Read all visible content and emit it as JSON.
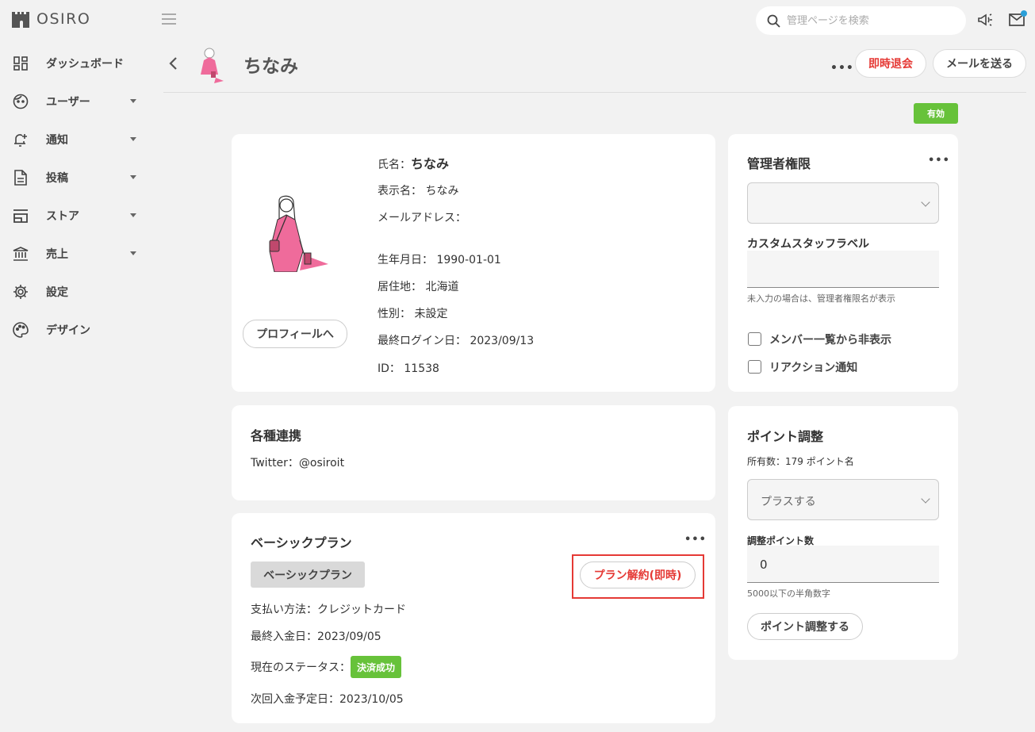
{
  "app": {
    "name": "OSIRO"
  },
  "sidebar": {
    "items": [
      {
        "label": "ダッシュボード",
        "icon": "dashboard-icon"
      },
      {
        "label": "ユーザー",
        "icon": "user-face-icon"
      },
      {
        "label": "通知",
        "icon": "bell-plus-icon"
      },
      {
        "label": "投稿",
        "icon": "document-icon"
      },
      {
        "label": "ストア",
        "icon": "store-icon"
      },
      {
        "label": "売上",
        "icon": "bank-icon"
      },
      {
        "label": "設定",
        "icon": "gear-icon"
      },
      {
        "label": "デザイン",
        "icon": "palette-icon"
      }
    ]
  },
  "search": {
    "placeholder": "管理ページを検索"
  },
  "header": {
    "name": "ちなみ",
    "withdraw_label": "即時退会",
    "send_mail_label": "メールを送る",
    "status_badge": "有効"
  },
  "profile": {
    "name_label": "氏名：",
    "name": "ちなみ",
    "display_name_label": "表示名：",
    "display_name": "ちなみ",
    "email_label": "メールアドレス：",
    "birthday_label": "生年月日：",
    "birthday": "1990-01-01",
    "residence_label": "居住地：",
    "residence": "北海道",
    "gender_label": "性別：",
    "gender": "未設定",
    "last_login_label": "最終ログイン日：",
    "last_login": "2023/09/13",
    "id_label": "ID：",
    "id": "11538",
    "profile_button": "プロフィールへ"
  },
  "integrations": {
    "title": "各種連携",
    "twitter_label": "Twitter：",
    "twitter": "@osiroit"
  },
  "plan": {
    "title": "ベーシックプラン",
    "plan_button": "ベーシックプラン",
    "cancel_button": "プラン解約(即時)",
    "payment_label": "支払い方法：",
    "payment": "クレジットカード",
    "last_paid_label": "最終入金日：",
    "last_paid": "2023/09/05",
    "status_label": "現在のステータス：",
    "status": "決済成功",
    "next_paid_label": "次回入金予定日：",
    "next_paid": "2023/10/05"
  },
  "admin": {
    "title": "管理者権限",
    "role_value": "",
    "custom_label_title": "カスタムスタッフラベル",
    "custom_label_value": "",
    "custom_label_help": "未入力の場合は、管理者権限名が表示",
    "hide_member_label": "メンバー一覧から非表示",
    "reaction_label": "リアクション通知"
  },
  "points": {
    "title": "ポイント調整",
    "owned": "所有数：179 ポイント名",
    "mode_value": "プラスする",
    "amount_label": "調整ポイント数",
    "amount_value": "0",
    "amount_help": "5000以下の半角数字",
    "submit_label": "ポイント調整する"
  },
  "colors": {
    "accent_red": "#e53935",
    "success_green": "#67c23a",
    "notification_dot": "#2a9fd8"
  }
}
